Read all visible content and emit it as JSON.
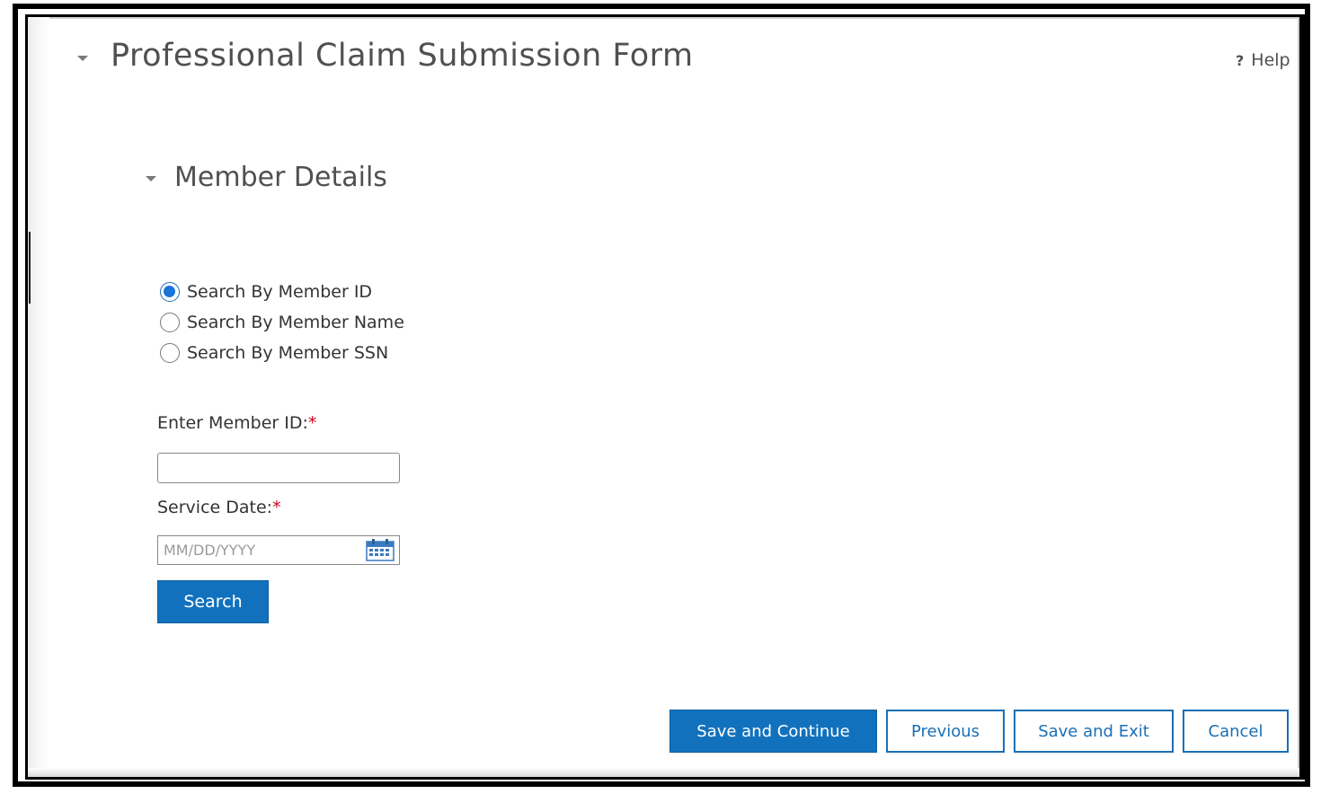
{
  "header": {
    "title": "Professional Claim Submission Form",
    "help_glyph": "?",
    "help_label": "Help"
  },
  "member_details": {
    "section_title": "Member Details",
    "search_options": [
      {
        "label": "Search By Member ID",
        "selected": true
      },
      {
        "label": "Search By Member Name",
        "selected": false
      },
      {
        "label": "Search By Member SSN",
        "selected": false
      }
    ],
    "member_id": {
      "label": "Enter Member ID:",
      "required_mark": "*",
      "value": "",
      "placeholder": ""
    },
    "service_date": {
      "label": "Service Date:",
      "required_mark": "*",
      "value": "",
      "placeholder": "MM/DD/YYYY"
    },
    "search_button": "Search"
  },
  "footer": {
    "save_continue": "Save and Continue",
    "previous": "Previous",
    "save_exit": "Save and Exit",
    "cancel": "Cancel"
  },
  "icons": {
    "collapse": "caret-down-icon",
    "calendar": "calendar-icon"
  },
  "colors": {
    "primary": "#1271bd",
    "required": "#d0021b",
    "radio_selected": "#1a73d8"
  }
}
